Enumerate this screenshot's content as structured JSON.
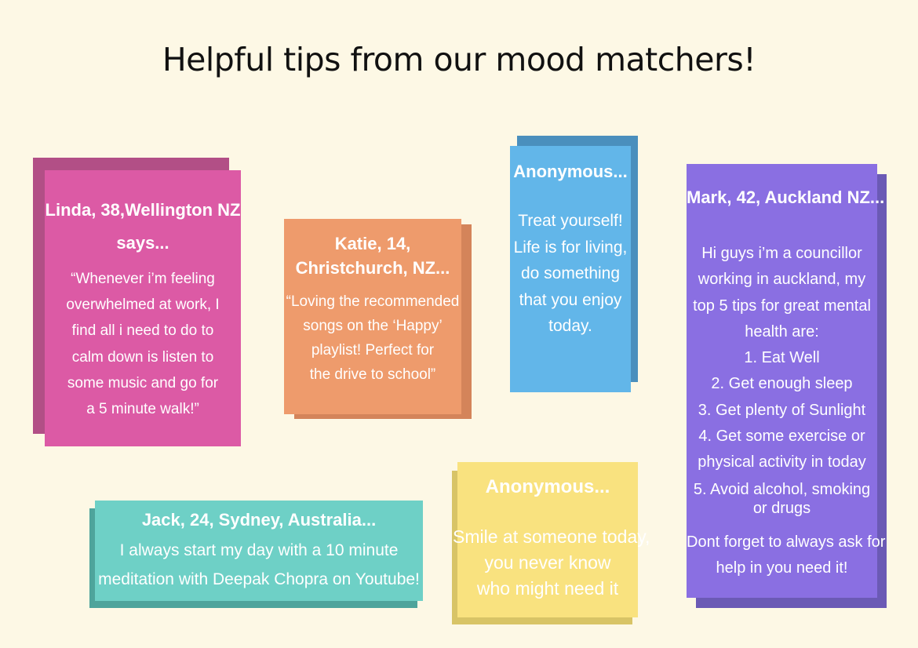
{
  "title": "Helpful tips from our mood matchers!",
  "colors": {
    "background": "#fdf8e5",
    "linda": "#dc5aa5",
    "katie": "#ee9b6c",
    "anonymous_blue": "#62b6e9",
    "mark": "#8a6fe2",
    "jack": "#6ed0c6",
    "anonymous_yellow": "#f9e27f"
  },
  "cards": {
    "linda": {
      "head": [
        "Linda, 38,Wellington NZ",
        "says..."
      ],
      "body": [
        "“Whenever i’m feeling",
        "overwhelmed at work, I",
        "find all i need to do to",
        "calm down is listen to",
        "some music and go for",
        "a 5 minute walk!”"
      ]
    },
    "katie": {
      "head": [
        "Katie, 14,",
        "Christchurch, NZ..."
      ],
      "body": [
        "“Loving the recommended",
        "songs on the ‘Happy’",
        "playlist! Perfect for",
        "the drive to school”"
      ]
    },
    "anon1": {
      "head": [
        "Anonymous..."
      ],
      "body": [
        "Treat yourself!",
        "Life is for living,",
        "do something",
        "that you enjoy",
        "today."
      ]
    },
    "mark": {
      "head": [
        "Mark, 42, Auckland NZ..."
      ],
      "body": [
        "Hi guys i’m a councillor",
        "working in auckland, my",
        "top 5 tips for great mental",
        "health are:",
        "1. Eat Well",
        "2. Get enough sleep",
        "3. Get plenty of Sunlight",
        "4. Get some exercise or",
        "physical activity in today",
        "5.  Avoid alcohol, smoking",
        "or drugs",
        "Dont forget to always ask for",
        "help in you need it!"
      ]
    },
    "jack": {
      "head": [
        "Jack, 24, Sydney, Australia..."
      ],
      "body": [
        "I always start my day with a 10 minute",
        "meditation with Deepak Chopra on Youtube!"
      ]
    },
    "anon2": {
      "head": [
        "Anonymous..."
      ],
      "body": [
        "Smile at someone today,",
        "you never know",
        "who might need it"
      ]
    }
  }
}
